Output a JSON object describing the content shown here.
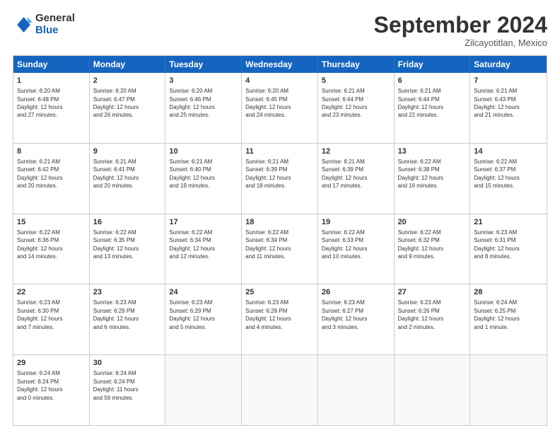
{
  "logo": {
    "line1": "General",
    "line2": "Blue"
  },
  "title": "September 2024",
  "subtitle": "Zilcayotitlan, Mexico",
  "header_days": [
    "Sunday",
    "Monday",
    "Tuesday",
    "Wednesday",
    "Thursday",
    "Friday",
    "Saturday"
  ],
  "rows": [
    [
      {
        "day": "1",
        "text": "Sunrise: 6:20 AM\nSunset: 6:48 PM\nDaylight: 12 hours\nand 27 minutes."
      },
      {
        "day": "2",
        "text": "Sunrise: 6:20 AM\nSunset: 6:47 PM\nDaylight: 12 hours\nand 26 minutes."
      },
      {
        "day": "3",
        "text": "Sunrise: 6:20 AM\nSunset: 6:46 PM\nDaylight: 12 hours\nand 25 minutes."
      },
      {
        "day": "4",
        "text": "Sunrise: 6:20 AM\nSunset: 6:45 PM\nDaylight: 12 hours\nand 24 minutes."
      },
      {
        "day": "5",
        "text": "Sunrise: 6:21 AM\nSunset: 6:44 PM\nDaylight: 12 hours\nand 23 minutes."
      },
      {
        "day": "6",
        "text": "Sunrise: 6:21 AM\nSunset: 6:44 PM\nDaylight: 12 hours\nand 22 minutes."
      },
      {
        "day": "7",
        "text": "Sunrise: 6:21 AM\nSunset: 6:43 PM\nDaylight: 12 hours\nand 21 minutes."
      }
    ],
    [
      {
        "day": "8",
        "text": "Sunrise: 6:21 AM\nSunset: 6:42 PM\nDaylight: 12 hours\nand 20 minutes."
      },
      {
        "day": "9",
        "text": "Sunrise: 6:21 AM\nSunset: 6:41 PM\nDaylight: 12 hours\nand 20 minutes."
      },
      {
        "day": "10",
        "text": "Sunrise: 6:21 AM\nSunset: 6:40 PM\nDaylight: 12 hours\nand 19 minutes."
      },
      {
        "day": "11",
        "text": "Sunrise: 6:21 AM\nSunset: 6:39 PM\nDaylight: 12 hours\nand 18 minutes."
      },
      {
        "day": "12",
        "text": "Sunrise: 6:21 AM\nSunset: 6:39 PM\nDaylight: 12 hours\nand 17 minutes."
      },
      {
        "day": "13",
        "text": "Sunrise: 6:22 AM\nSunset: 6:38 PM\nDaylight: 12 hours\nand 16 minutes."
      },
      {
        "day": "14",
        "text": "Sunrise: 6:22 AM\nSunset: 6:37 PM\nDaylight: 12 hours\nand 15 minutes."
      }
    ],
    [
      {
        "day": "15",
        "text": "Sunrise: 6:22 AM\nSunset: 6:36 PM\nDaylight: 12 hours\nand 14 minutes."
      },
      {
        "day": "16",
        "text": "Sunrise: 6:22 AM\nSunset: 6:35 PM\nDaylight: 12 hours\nand 13 minutes."
      },
      {
        "day": "17",
        "text": "Sunrise: 6:22 AM\nSunset: 6:34 PM\nDaylight: 12 hours\nand 12 minutes."
      },
      {
        "day": "18",
        "text": "Sunrise: 6:22 AM\nSunset: 6:34 PM\nDaylight: 12 hours\nand 11 minutes."
      },
      {
        "day": "19",
        "text": "Sunrise: 6:22 AM\nSunset: 6:33 PM\nDaylight: 12 hours\nand 10 minutes."
      },
      {
        "day": "20",
        "text": "Sunrise: 6:22 AM\nSunset: 6:32 PM\nDaylight: 12 hours\nand 9 minutes."
      },
      {
        "day": "21",
        "text": "Sunrise: 6:23 AM\nSunset: 6:31 PM\nDaylight: 12 hours\nand 8 minutes."
      }
    ],
    [
      {
        "day": "22",
        "text": "Sunrise: 6:23 AM\nSunset: 6:30 PM\nDaylight: 12 hours\nand 7 minutes."
      },
      {
        "day": "23",
        "text": "Sunrise: 6:23 AM\nSunset: 6:29 PM\nDaylight: 12 hours\nand 6 minutes."
      },
      {
        "day": "24",
        "text": "Sunrise: 6:23 AM\nSunset: 6:29 PM\nDaylight: 12 hours\nand 5 minutes."
      },
      {
        "day": "25",
        "text": "Sunrise: 6:23 AM\nSunset: 6:28 PM\nDaylight: 12 hours\nand 4 minutes."
      },
      {
        "day": "26",
        "text": "Sunrise: 6:23 AM\nSunset: 6:27 PM\nDaylight: 12 hours\nand 3 minutes."
      },
      {
        "day": "27",
        "text": "Sunrise: 6:23 AM\nSunset: 6:26 PM\nDaylight: 12 hours\nand 2 minutes."
      },
      {
        "day": "28",
        "text": "Sunrise: 6:24 AM\nSunset: 6:25 PM\nDaylight: 12 hours\nand 1 minute."
      }
    ],
    [
      {
        "day": "29",
        "text": "Sunrise: 6:24 AM\nSunset: 6:24 PM\nDaylight: 12 hours\nand 0 minutes."
      },
      {
        "day": "30",
        "text": "Sunrise: 6:24 AM\nSunset: 6:24 PM\nDaylight: 11 hours\nand 59 minutes."
      },
      {
        "day": "",
        "text": ""
      },
      {
        "day": "",
        "text": ""
      },
      {
        "day": "",
        "text": ""
      },
      {
        "day": "",
        "text": ""
      },
      {
        "day": "",
        "text": ""
      }
    ]
  ]
}
